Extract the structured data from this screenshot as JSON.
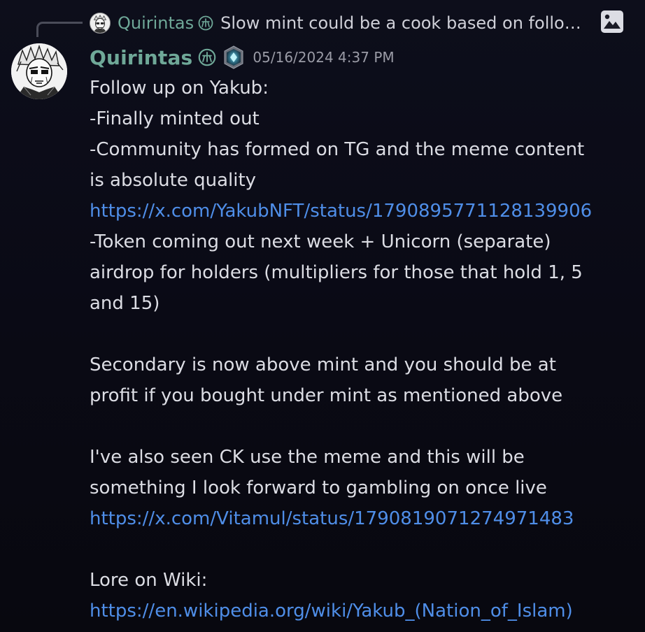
{
  "reply": {
    "author": "Quirintas",
    "text": "Slow mint could be a cook based on follow..."
  },
  "message": {
    "author": "Quirintas",
    "timestamp": "05/16/2024 4:37 PM",
    "lines": [
      {
        "text": "Follow up on Yakub:",
        "link": false
      },
      {
        "text": "-Finally minted out",
        "link": false
      },
      {
        "text": "-Community has formed on TG and the meme content",
        "link": false
      },
      {
        "text": "is absolute quality",
        "link": false
      },
      {
        "text": "https://x.com/YakubNFT/status/1790895771128139906",
        "link": true
      },
      {
        "text": "-Token coming out next week + Unicorn (separate)",
        "link": false
      },
      {
        "text": "airdrop for holders (multipliers for those that hold 1, 5",
        "link": false
      },
      {
        "text": "and 15)",
        "link": false
      },
      {
        "text": "",
        "link": false
      },
      {
        "text": "Secondary is now above mint and you should be at",
        "link": false
      },
      {
        "text": "profit if you bought under mint as mentioned above",
        "link": false
      },
      {
        "text": "",
        "link": false
      },
      {
        "text": "I've also seen CK use the meme and this will be",
        "link": false
      },
      {
        "text": "something I look forward to gambling on once live",
        "link": false
      },
      {
        "text": "https://x.com/Vitamul/status/1790819071274971483",
        "link": true
      },
      {
        "text": "",
        "link": false
      },
      {
        "text": "Lore on Wiki:",
        "link": false
      },
      {
        "text": "https://en.wikipedia.org/wiki/Yakub_(Nation_of_Islam)",
        "link": true
      }
    ]
  },
  "colors": {
    "author": "#6fa898",
    "link": "#4f8ee8",
    "background": "#0d0e1b"
  },
  "icons": {
    "role": "role-icon",
    "badge": "server-badge-icon",
    "image": "image-icon"
  }
}
